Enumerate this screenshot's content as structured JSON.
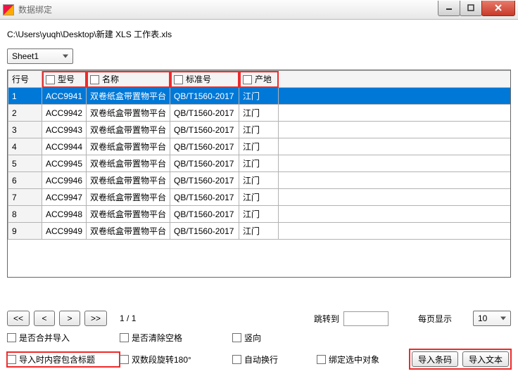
{
  "window": {
    "title": "数据绑定"
  },
  "filepath": "C:\\Users\\yuqh\\Desktop\\新建 XLS 工作表.xls",
  "sheet_selector": {
    "value": "Sheet1"
  },
  "grid": {
    "rowno_header": "行号",
    "columns": [
      {
        "key": "model",
        "label": "型号"
      },
      {
        "key": "name",
        "label": "名称"
      },
      {
        "key": "std",
        "label": "标准号"
      },
      {
        "key": "place",
        "label": "产地"
      }
    ],
    "rows": [
      {
        "no": "1",
        "model": "ACC9941",
        "name": "双卷纸盒带置物平台",
        "std": "QB/T1560-2017",
        "place": "江门"
      },
      {
        "no": "2",
        "model": "ACC9942",
        "name": "双卷纸盒带置物平台",
        "std": "QB/T1560-2017",
        "place": "江门"
      },
      {
        "no": "3",
        "model": "ACC9943",
        "name": "双卷纸盒带置物平台",
        "std": "QB/T1560-2017",
        "place": "江门"
      },
      {
        "no": "4",
        "model": "ACC9944",
        "name": "双卷纸盒带置物平台",
        "std": "QB/T1560-2017",
        "place": "江门"
      },
      {
        "no": "5",
        "model": "ACC9945",
        "name": "双卷纸盒带置物平台",
        "std": "QB/T1560-2017",
        "place": "江门"
      },
      {
        "no": "6",
        "model": "ACC9946",
        "name": "双卷纸盒带置物平台",
        "std": "QB/T1560-2017",
        "place": "江门"
      },
      {
        "no": "7",
        "model": "ACC9947",
        "name": "双卷纸盒带置物平台",
        "std": "QB/T1560-2017",
        "place": "江门"
      },
      {
        "no": "8",
        "model": "ACC9948",
        "name": "双卷纸盒带置物平台",
        "std": "QB/T1560-2017",
        "place": "江门"
      },
      {
        "no": "9",
        "model": "ACC9949",
        "name": "双卷纸盒带置物平台",
        "std": "QB/T1560-2017",
        "place": "江门"
      }
    ]
  },
  "pager": {
    "first": "<<",
    "prev": "<",
    "next": ">",
    "last": ">>",
    "page_text": "1 / 1",
    "jump_label": "跳转到",
    "jump_value": "",
    "page_size_label": "每页显示",
    "page_size_value": "10"
  },
  "options": {
    "merge_import": "是否合并导入",
    "clear_blank": "是否清除空格",
    "vertical": "竖向",
    "include_header": "导入时内容包含标题",
    "double_rotate": "双数段旋转180°",
    "auto_wrap": "自动换行",
    "bind_selected": "绑定选中对象"
  },
  "buttons": {
    "import_barcode": "导入条码",
    "import_text": "导入文本"
  }
}
